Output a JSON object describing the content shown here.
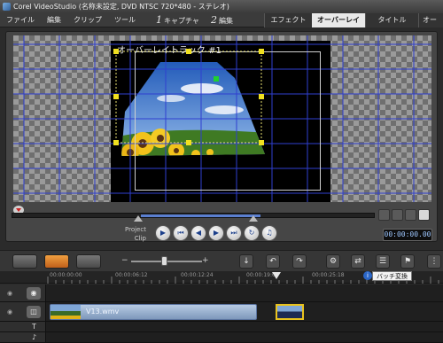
{
  "window": {
    "title": "Corel VideoStudio (名称未設定, DVD NTSC 720*480 - ステレオ)"
  },
  "menu": [
    {
      "label": "ファイル"
    },
    {
      "label": "編集"
    },
    {
      "label": "クリップ"
    },
    {
      "label": "ツール"
    }
  ],
  "steps": {
    "capture": {
      "num": "1",
      "label": "キャプチャ"
    },
    "edit": {
      "num": "2",
      "label": "編集"
    }
  },
  "tabs": {
    "effect": "エフェクト",
    "overlay": "オーバーレイ",
    "title": "タイトル",
    "audio": "オー"
  },
  "preview": {
    "overlay_track_label": "オーバーレイトラック #1"
  },
  "player": {
    "project_label": "Project",
    "clip_label": "Clip",
    "timecode": "00:00:00.00"
  },
  "timeline": {
    "ruler_labels": [
      "00:00:00:00",
      "00:00:06:12",
      "00:00:12:24",
      "00:00:19:06",
      "00:00:25:18"
    ],
    "tooltip": "バッチ変換",
    "clips": {
      "video_clip_name": "V13.wmv"
    },
    "track_icons": {
      "title": "T",
      "voice": "♪"
    }
  },
  "colors": {
    "accent_orange": "#f0a040",
    "grid_blue": "#2f3fd0",
    "handle_yellow": "#f0e020",
    "selection_blue": "#5a7fd0"
  },
  "icons": [
    "app-icon",
    "play-icon",
    "home-icon",
    "prev-frame-icon",
    "next-frame-icon",
    "end-icon",
    "repeat-icon",
    "volume-icon",
    "zoom-in-icon",
    "zoom-out-icon",
    "film-icon",
    "lock-icon"
  ]
}
